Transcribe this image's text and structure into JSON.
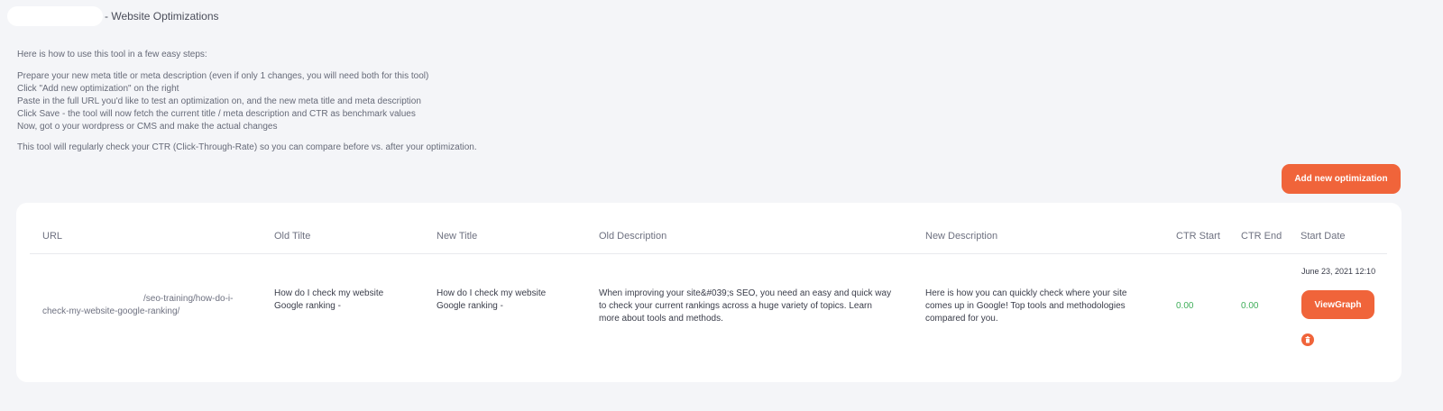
{
  "header": {
    "title": "- Website Optimizations"
  },
  "instructions": {
    "intro": "Here is how to use this tool in a few easy steps:",
    "steps": [
      "Prepare your new meta title or meta description (even if only 1 changes, you will need both for this tool)",
      "Click \"Add new optimization\" on the right",
      "Paste in the full URL you'd like to test an optimization on, and the new meta title and meta description",
      "Click Save - the tool will now fetch the current title / meta description and CTR as benchmark values",
      "Now, got o your wordpress or CMS and make the actual changes"
    ],
    "outro": "This tool will regularly check your CTR (Click-Through-Rate) so you can compare before vs. after your optimization."
  },
  "actions": {
    "add_label": "Add new optimization"
  },
  "table": {
    "headers": {
      "url": "URL",
      "old_title": "Old Tilte",
      "new_title": "New Title",
      "old_description": "Old Description",
      "new_description": "New Description",
      "ctr_start": "CTR Start",
      "ctr_end": "CTR End",
      "start_date": "Start Date"
    },
    "rows": [
      {
        "url_part1": "/seo-training/how-do-i-",
        "url_part2": "check-my-website-google-ranking/",
        "old_title_line1": "How do I check my website",
        "old_title_line2": "Google ranking -",
        "new_title_line1": "How do I check my website",
        "new_title_line2": "Google ranking -",
        "old_description_line1": "When improving your site&#039;s SEO, you need an easy and quick way",
        "old_description_line2": "to check your current rankings across a huge variety of topics. Learn",
        "old_description_line3": "more about tools and methods.",
        "new_description_line1": "Here is how you can quickly check where your site",
        "new_description_line2": "comes up in Google! Top tools and methodologies",
        "new_description_line3": "compared for you.",
        "ctr_start": "0.00",
        "ctr_end": "0.00",
        "start_date": "June 23, 2021 12:10",
        "view_label": "ViewGraph"
      }
    ]
  },
  "icons": {
    "delete": "trash-icon"
  },
  "colors": {
    "accent": "#f0643a",
    "ctr_value": "#3fae5a",
    "background": "#f4f5f8"
  }
}
